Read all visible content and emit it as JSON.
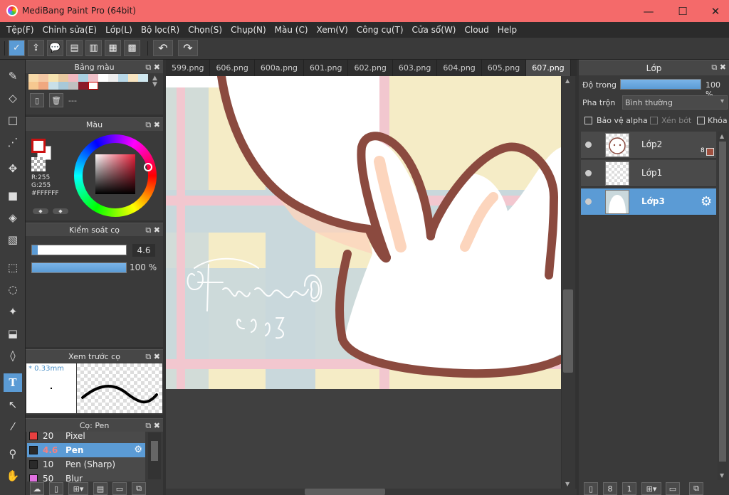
{
  "window": {
    "title": "MediBang Paint Pro (64bit)",
    "minimize": "—",
    "maximize": "☐",
    "close": "✕"
  },
  "menu": [
    "Tệp(F)",
    "Chỉnh sửa(E)",
    "Lớp(L)",
    "Bộ lọc(R)",
    "Chọn(S)",
    "Chụp(N)",
    "Màu (C)",
    "Xem(V)",
    "Công cụ(T)",
    "Cửa sổ(W)",
    "Cloud",
    "Help"
  ],
  "toolbar": {
    "undo": "↶",
    "redo": "↷"
  },
  "tabs": [
    "599.png",
    "606.png",
    "600a.png",
    "601.png",
    "602.png",
    "603.png",
    "604.png",
    "605.png",
    "607.png"
  ],
  "active_tab": "607.png",
  "palette_panel": {
    "title": "Bảng màu",
    "name_placeholder": "---"
  },
  "color_panel": {
    "title": "Màu",
    "r": "R:255",
    "g": "G:255",
    "hex": "#FFFFFF",
    "main_color": "#cc1111"
  },
  "brush_control": {
    "title": "Kiểm soát cọ",
    "size": "4.6",
    "opacity": "100 %",
    "opacity_fraction": 1.0
  },
  "brush_preview": {
    "title": "Xem trước cọ",
    "size_label": "* 0.33mm"
  },
  "brush_list": {
    "title": "Cọ: Pen",
    "items": [
      {
        "size": "20",
        "name": "Pixel",
        "color": "#e84040"
      },
      {
        "size": "4.6",
        "name": "Pen",
        "color": "#2a2a2a"
      },
      {
        "size": "10",
        "name": "Pen (Sharp)",
        "color": "#2a2a2a"
      },
      {
        "size": "50",
        "name": "Blur",
        "color": "#e070e0"
      }
    ]
  },
  "layer_panel": {
    "title": "Lớp",
    "opacity_label": "Độ trong",
    "opacity_value": "100 %",
    "opacity_fraction": 1.0,
    "blend_label": "Pha trộn",
    "blend_value": "Bình thường",
    "protect_alpha": "Bảo vệ alpha",
    "clipping": "Xén bớt",
    "lock": "Khóa",
    "layers": [
      {
        "name": "Lớp2",
        "badge": "8"
      },
      {
        "name": "Lớp1"
      },
      {
        "name": "Lớp3"
      }
    ]
  }
}
